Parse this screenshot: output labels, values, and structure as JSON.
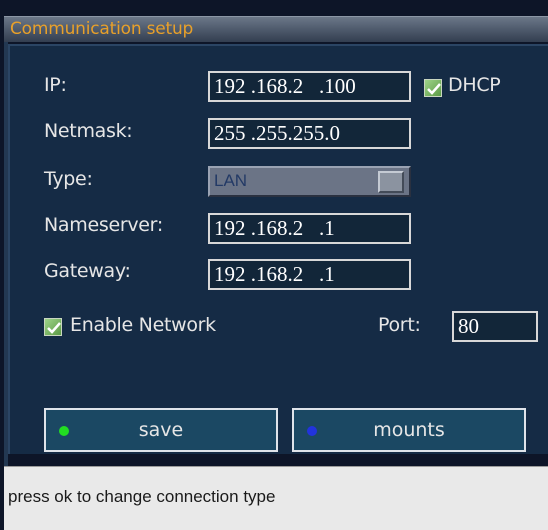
{
  "window": {
    "title": "Communication setup"
  },
  "form": {
    "ip": {
      "label": "IP:",
      "value": "192 .168.2   .100"
    },
    "dhcp": {
      "label": "DHCP",
      "checked": true
    },
    "netmask": {
      "label": "Netmask:",
      "value": "255 .255.255.0"
    },
    "type": {
      "label": "Type:",
      "value": "LAN"
    },
    "nameserver": {
      "label": "Nameserver:",
      "value": "192 .168.2   .1"
    },
    "gateway": {
      "label": "Gateway:",
      "value": "192 .168.2   .1"
    },
    "enable_network": {
      "label": "Enable Network",
      "checked": true
    },
    "port": {
      "label": "Port:",
      "value": "80"
    }
  },
  "buttons": {
    "save": {
      "label": "save",
      "dot_color": "#22dd22"
    },
    "mounts": {
      "label": "mounts",
      "dot_color": "#2233dd"
    }
  },
  "status": {
    "text": "press ok to change connection type"
  },
  "colors": {
    "title": "#e8a02a",
    "panel": "#152b45",
    "button": "#1b4863"
  }
}
